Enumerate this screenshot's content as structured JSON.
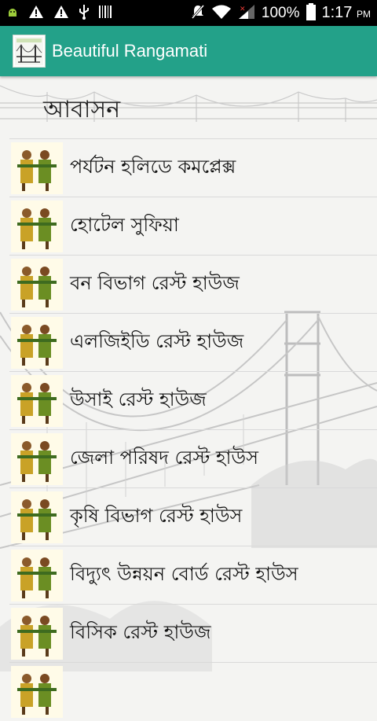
{
  "status_bar": {
    "battery_percent": "100%",
    "time": "1:17",
    "ampm": "PM",
    "icons": [
      "android-robot-icon",
      "warning-icon",
      "warning-icon",
      "usb-icon",
      "barcode-icon",
      "mute-icon",
      "wifi-icon",
      "signal-icon",
      "battery-icon"
    ]
  },
  "app_bar": {
    "title": "Beautiful Rangamati",
    "accent_color": "#23a189"
  },
  "page": {
    "section_title": "আবাসন",
    "items": [
      {
        "label": "পর্যটন হলিডে কমপ্লেক্স"
      },
      {
        "label": "হোটেল সুফিয়া"
      },
      {
        "label": "বন বিভাগ রেস্ট হাউজ"
      },
      {
        "label": "এলজিইডি রেস্ট হাউজ"
      },
      {
        "label": "উসাই রেস্ট হাউজ"
      },
      {
        "label": "জেলা পরিষদ রেস্ট হাউস"
      },
      {
        "label": "কৃষি বিভাগ রেস্ট হাউস"
      },
      {
        "label": "বিদ্যুৎ উন্নয়ন বোর্ড রেস্ট হাউস"
      },
      {
        "label": "বিসিক রেস্ট হাউজ"
      },
      {
        "label": ""
      }
    ]
  }
}
